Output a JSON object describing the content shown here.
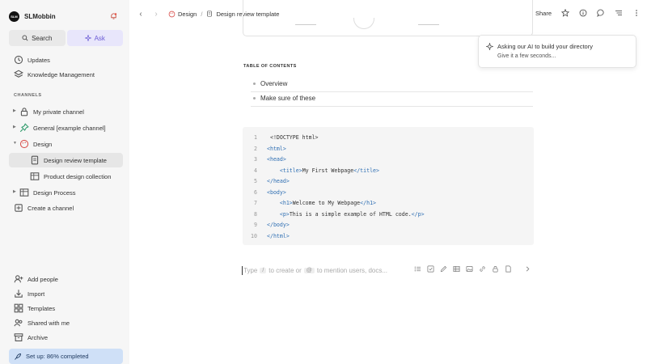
{
  "workspace": {
    "logo_text": "SLM",
    "name": "SLMobbin"
  },
  "sidebar": {
    "search_label": "Search",
    "ask_label": "Ask",
    "top_items": [
      {
        "label": "Updates",
        "icon": "clock-icon"
      },
      {
        "label": "Knowledge Management",
        "icon": "layers-icon"
      }
    ],
    "channels_heading": "CHANNELS",
    "channels": [
      {
        "label": "My private channel",
        "icon": "lock-icon"
      },
      {
        "label": "General [example channel]",
        "icon": "pin-icon"
      },
      {
        "label": "Design",
        "icon": "palette-icon"
      },
      {
        "label": "Design review template",
        "icon": "page-icon"
      },
      {
        "label": "Product design collection",
        "icon": "table-icon"
      },
      {
        "label": "Design Process",
        "icon": "table-icon"
      },
      {
        "label": "Create a channel",
        "icon": "create-icon"
      }
    ],
    "bottom_items": [
      {
        "label": "Add people",
        "icon": "add-person-icon"
      },
      {
        "label": "Import",
        "icon": "import-icon"
      },
      {
        "label": "Templates",
        "icon": "templates-icon"
      },
      {
        "label": "Shared with me",
        "icon": "shared-icon"
      },
      {
        "label": "Archive",
        "icon": "archive-icon"
      }
    ],
    "setup_label": "Set up: 86% completed",
    "setup_progress": 86
  },
  "breadcrumb": {
    "parent": "Design",
    "separator": "/",
    "current": "Design review template"
  },
  "topbar": {
    "share_label": "Share"
  },
  "toc": {
    "heading": "TABLE OF CONTENTS",
    "items": [
      "Overview",
      "Make sure of these"
    ]
  },
  "code": {
    "lines": [
      {
        "n": "1",
        "indent": " ",
        "tag": "",
        "text": "<!DOCTYPE html>",
        "after": ""
      },
      {
        "n": "2",
        "indent": "",
        "tag": "<html>",
        "text": "",
        "after": ""
      },
      {
        "n": "3",
        "indent": "",
        "tag": "<head>",
        "text": "",
        "after": ""
      },
      {
        "n": "4",
        "indent": "    ",
        "tag": "<title>",
        "text": "My First Webpage",
        "after": "</title>"
      },
      {
        "n": "5",
        "indent": "",
        "tag": "</head>",
        "text": "",
        "after": ""
      },
      {
        "n": "6",
        "indent": "",
        "tag": "<body>",
        "text": "",
        "after": ""
      },
      {
        "n": "7",
        "indent": "    ",
        "tag": "<h1>",
        "text": "Welcome to My Webpage",
        "after": "</h1>"
      },
      {
        "n": "8",
        "indent": "    ",
        "tag": "<p>",
        "text": "This is a simple example of HTML code.",
        "after": "</p>"
      },
      {
        "n": "9",
        "indent": "",
        "tag": "</body>",
        "text": "",
        "after": ""
      },
      {
        "n": "10",
        "indent": "",
        "tag": "</html>",
        "text": "",
        "after": ""
      }
    ]
  },
  "editor": {
    "ph_type": "Type",
    "ph_slash": "/",
    "ph_create": "to create or",
    "ph_at": "@",
    "ph_mention": "to mention users, docs..."
  },
  "toast": {
    "title": "Asking our AI to build your directory",
    "subtitle": "Give it a few seconds..."
  },
  "colors": {
    "ask_accent": "#6b5bd6",
    "setup_bg": "#cfe0f7",
    "tag_blue": "#2f6fb3"
  }
}
